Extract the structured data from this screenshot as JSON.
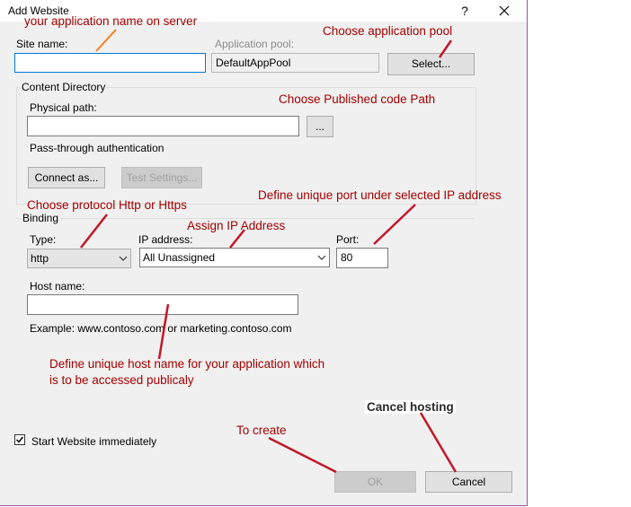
{
  "window": {
    "title": "Add Website",
    "help_label": "?"
  },
  "site": {
    "label": "Site name:",
    "value": ""
  },
  "app_pool": {
    "label": "Application pool:",
    "value": "DefaultAppPool",
    "select_button": "Select..."
  },
  "content_directory": {
    "title": "Content Directory",
    "physical_path_label": "Physical path:",
    "physical_path_value": "",
    "browse_button": "...",
    "pass_through_label": "Pass-through authentication",
    "connect_as_button": "Connect as...",
    "test_settings_button": "Test Settings..."
  },
  "binding": {
    "title": "Binding",
    "type_label": "Type:",
    "type_value": "http",
    "ip_label": "IP address:",
    "ip_value": "All Unassigned",
    "port_label": "Port:",
    "port_value": "80",
    "host_label": "Host name:",
    "host_value": "",
    "example_text": "Example: www.contoso.com or marketing.contoso.com"
  },
  "start_website": {
    "label": "Start Website immediately",
    "checked": true
  },
  "buttons": {
    "ok": "OK",
    "cancel": "Cancel"
  },
  "annotations": {
    "app_name": "your application name on server",
    "app_pool": "Choose application pool",
    "code_path": "Choose Published code Path",
    "protocol": "Choose protocol Http or Https",
    "port": "Define unique port under selected IP address",
    "ip": "Assign IP Address",
    "host": "Define unique host name for your application which is to be accessed publicaly",
    "cancel": "Cancel hosting",
    "create": "To create"
  },
  "colors": {
    "annotation": "#a30000",
    "focus_border": "#0078d7",
    "dialog_bg": "#f0f0f0"
  }
}
